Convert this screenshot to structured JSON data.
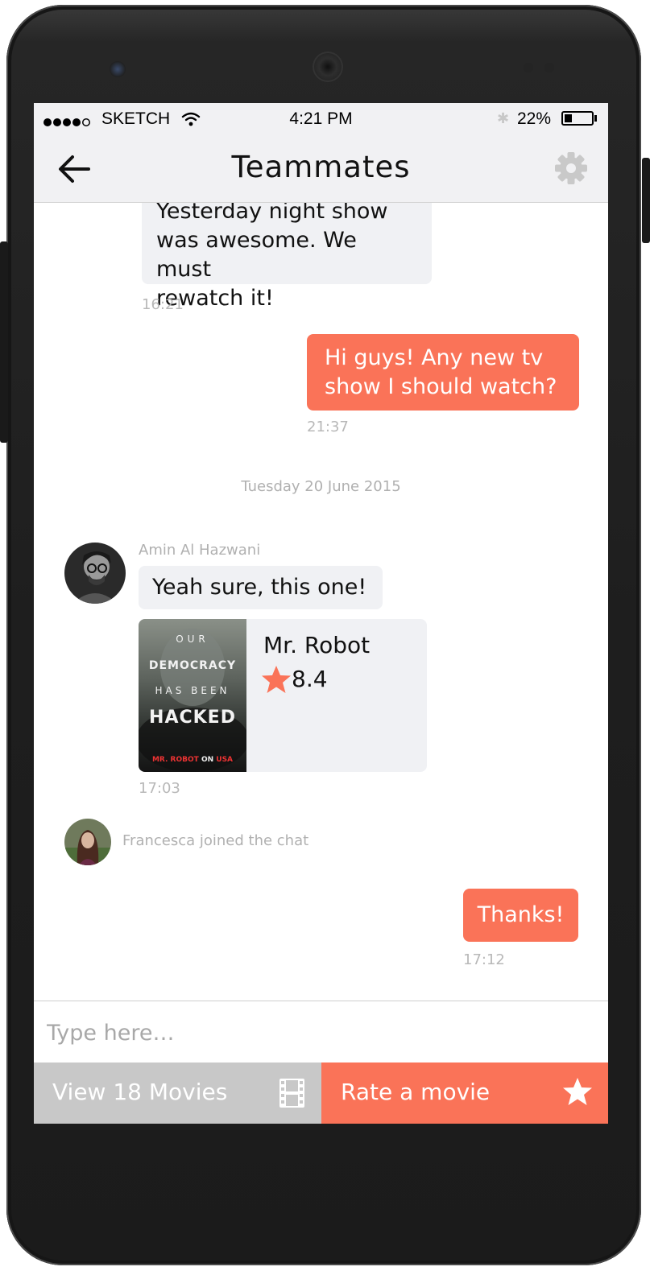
{
  "status_bar": {
    "carrier": "SKETCH",
    "time": "4:21 PM",
    "battery": "22%",
    "battery_level": 0.22
  },
  "header": {
    "title": "Teammates",
    "back_icon": "arrow-left-icon",
    "settings_icon": "gear-icon"
  },
  "messages": [
    {
      "type": "incoming",
      "lines": [
        "Yesterday night show",
        "was awesome. We must",
        "rewatch it!"
      ],
      "time": "16:21"
    },
    {
      "type": "outgoing",
      "lines": [
        "Hi guys! Any new tv",
        "show I should watch?"
      ],
      "time": "21:37"
    },
    {
      "type": "date",
      "text": "Tuesday 20 June 2015"
    },
    {
      "type": "incoming",
      "sender": "Amin Al Hazwani",
      "text": "Yeah sure, this one!"
    },
    {
      "type": "movie",
      "title": "Mr. Robot",
      "rating": "8.4",
      "poster_lines": [
        "OUR",
        "DEMOCRACY",
        "HAS BEEN",
        "HACKED",
        "MR. ROBOT",
        "ON",
        "USA"
      ],
      "time": "17:03"
    },
    {
      "type": "system",
      "text": "Francesca joined the chat"
    },
    {
      "type": "outgoing",
      "text": "Thanks!",
      "time": "17:12"
    }
  ],
  "composer": {
    "placeholder": "Type here…"
  },
  "actions": {
    "movies_label": "View 18 Movies",
    "movies_icon": "film-icon",
    "rate_label": "Rate a movie",
    "rate_icon": "star-icon"
  },
  "colors": {
    "accent": "#fa7358",
    "bubble_incoming": "#f0f1f4",
    "button_gray": "#c8c8c8",
    "timestamp": "#b8b8b8"
  }
}
